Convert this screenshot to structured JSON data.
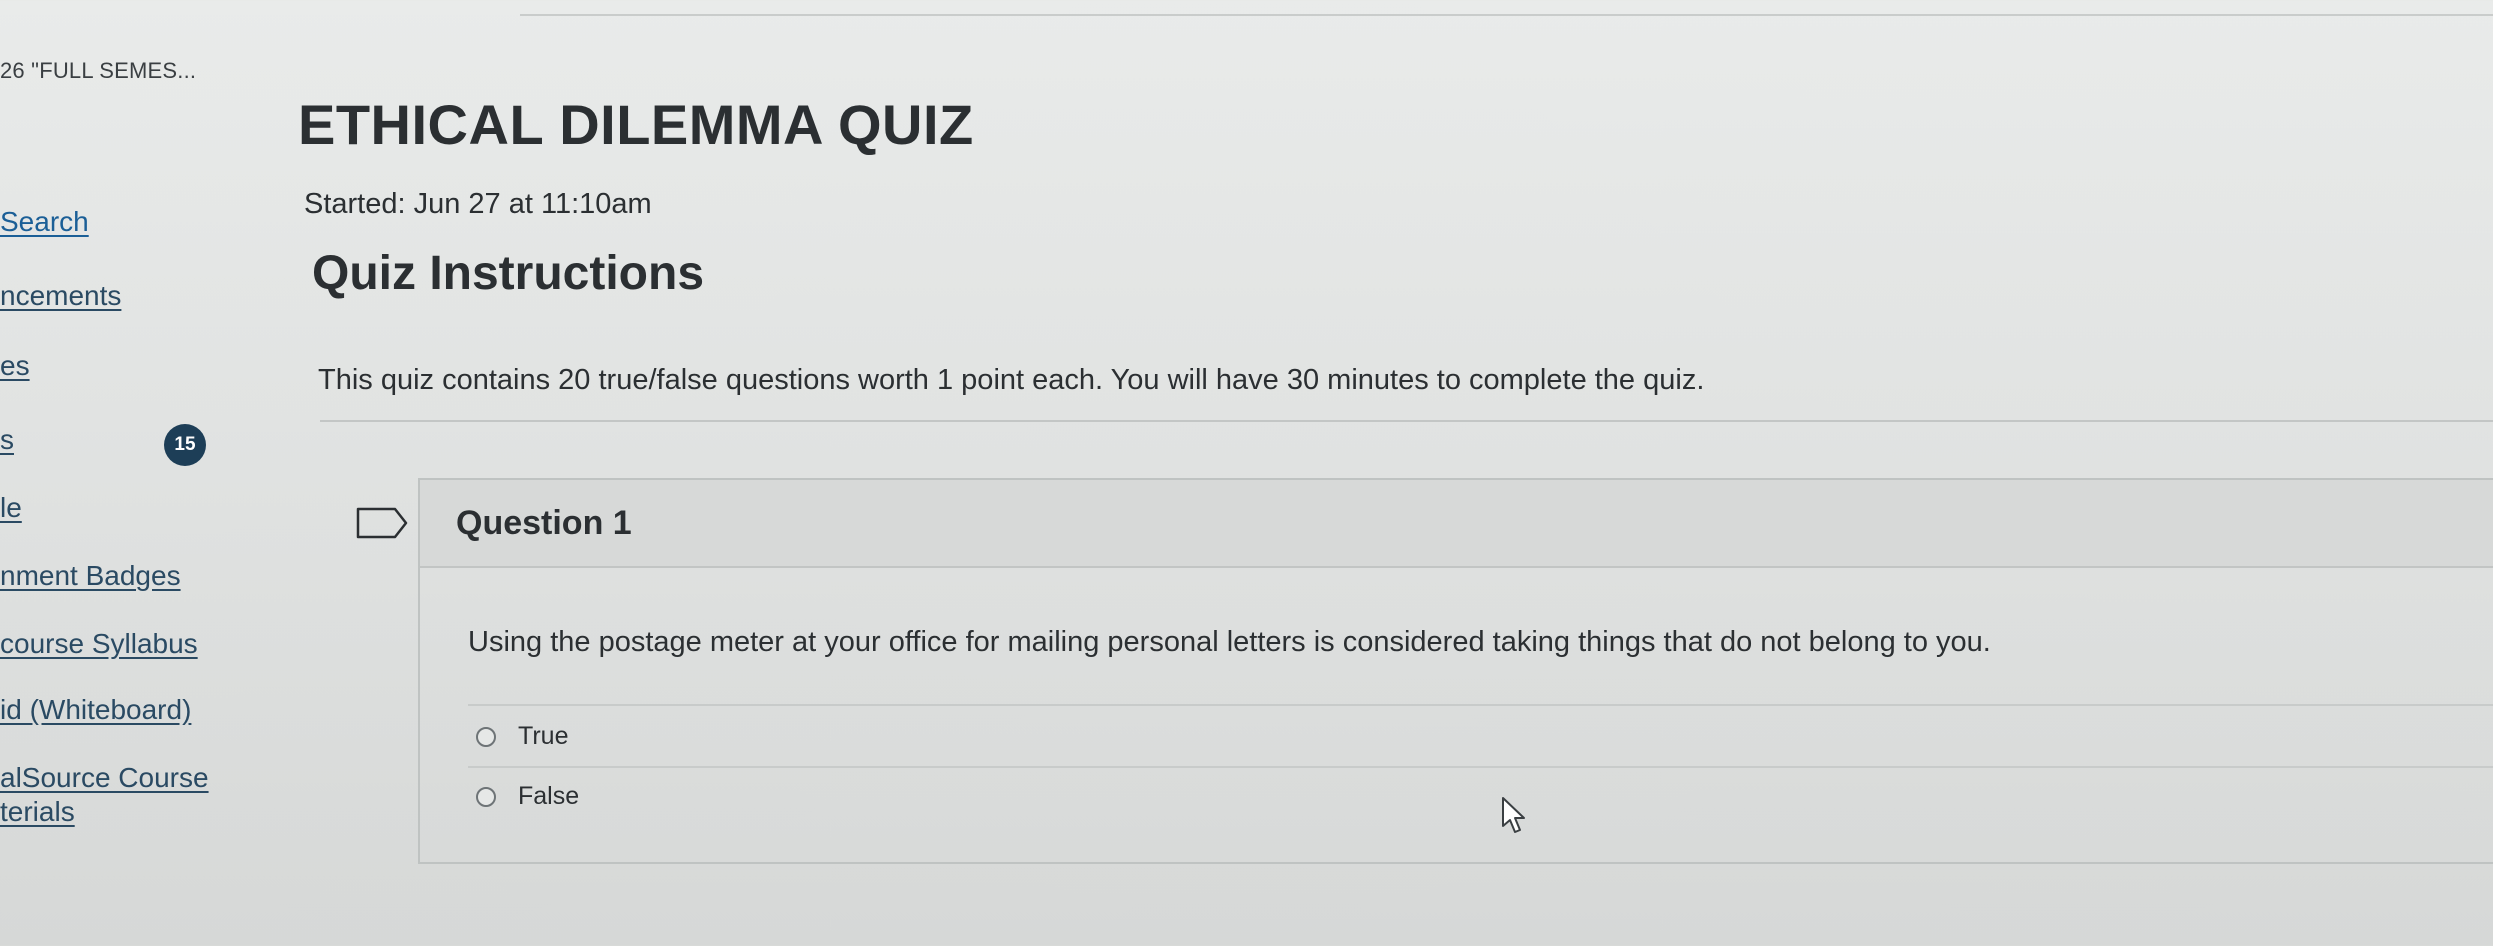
{
  "course": {
    "crumb": "26 \"FULL SEMES..."
  },
  "sidebar": {
    "items": [
      {
        "label": "Search"
      },
      {
        "label": "ncements"
      },
      {
        "label": "es"
      },
      {
        "label": "s",
        "badge": "15"
      },
      {
        "label": "le"
      },
      {
        "label": "nment Badges"
      },
      {
        "label": "course Syllabus"
      },
      {
        "label": "id (Whiteboard)"
      },
      {
        "label": "alSource Course"
      },
      {
        "label": "terials"
      }
    ]
  },
  "quiz": {
    "title": "ETHICAL DILEMMA QUIZ",
    "started": "Started: Jun 27 at 11:10am",
    "instructions_heading": "Quiz Instructions",
    "instructions_text": "This quiz contains 20 true/false questions worth 1 point each. You will have 30 minutes to complete the quiz."
  },
  "question": {
    "title": "Question 1",
    "text": "Using the postage meter at your office for mailing personal letters is considered taking things that do not belong to you.",
    "answers": [
      {
        "label": "True"
      },
      {
        "label": "False"
      }
    ]
  },
  "colors": {
    "link": "#1b5f97",
    "badge": "#1d3e57",
    "text": "#2b2f32"
  }
}
